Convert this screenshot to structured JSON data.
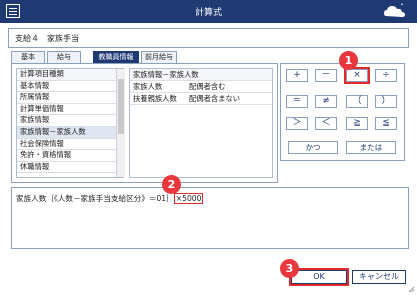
{
  "window": {
    "title": "計算式"
  },
  "header_field": {
    "value": "支給４　家族手当"
  },
  "tabs": [
    {
      "label": "基本",
      "active": false
    },
    {
      "label": "給与",
      "active": false
    },
    {
      "label": "教職員情報",
      "active": true
    },
    {
      "label": "前月給与",
      "active": false
    }
  ],
  "item_list": {
    "header": "計算項目種類",
    "items": [
      "基本情報",
      "所属情報",
      "計算単価情報",
      "家族情報",
      "家族情報－家族人数",
      "社会保険情報",
      "免許・資格情報",
      "休職情報"
    ],
    "selected_index": 4
  },
  "detail_list": {
    "header": "家族情報－家族人数",
    "rows": [
      {
        "name": "家族人数",
        "desc": "配偶者含む"
      },
      {
        "name": "扶養親族人数",
        "desc": "配偶者含まない"
      }
    ]
  },
  "operators": {
    "plus": "+",
    "minus": "－",
    "times": "×",
    "divide": "÷",
    "equal": "＝",
    "notequal": "≠",
    "lparen": "（",
    "rparen": "）",
    "gt": "＞",
    "lt": "＜",
    "ge": "≧",
    "le": "≦",
    "and": "かつ",
    "or": "または"
  },
  "formula": {
    "text": "家族人数｛《人数－家族手当支給区分》＝01｝",
    "highlight": "×5000"
  },
  "buttons": {
    "ok": "OK",
    "cancel": "キャンセル"
  },
  "callouts": [
    "1",
    "2",
    "3"
  ],
  "colors": {
    "titlebar": "#1f3a73",
    "accent": "#e32a2a",
    "badge": "#e8383d"
  }
}
